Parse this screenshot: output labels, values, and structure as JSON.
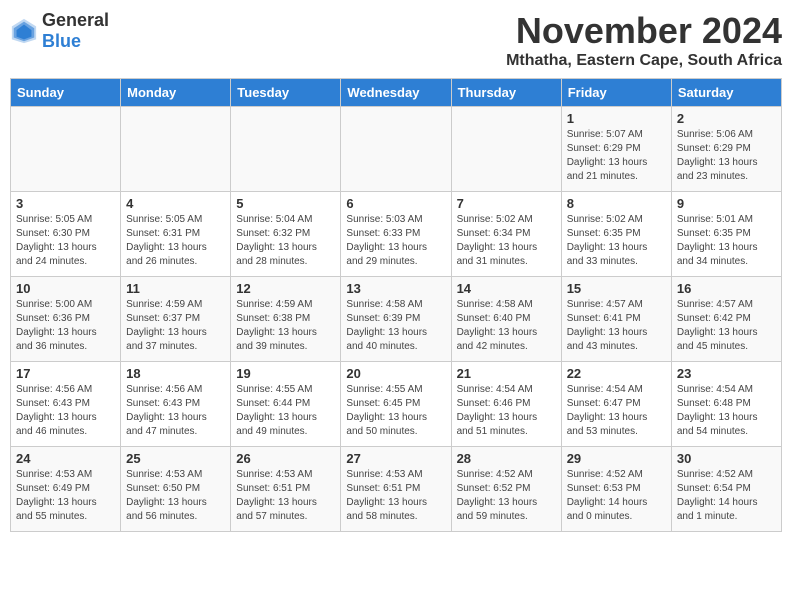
{
  "header": {
    "logo_general": "General",
    "logo_blue": "Blue",
    "month_title": "November 2024",
    "location": "Mthatha, Eastern Cape, South Africa"
  },
  "days_of_week": [
    "Sunday",
    "Monday",
    "Tuesday",
    "Wednesday",
    "Thursday",
    "Friday",
    "Saturday"
  ],
  "weeks": [
    [
      {
        "day": "",
        "info": ""
      },
      {
        "day": "",
        "info": ""
      },
      {
        "day": "",
        "info": ""
      },
      {
        "day": "",
        "info": ""
      },
      {
        "day": "",
        "info": ""
      },
      {
        "day": "1",
        "info": "Sunrise: 5:07 AM\nSunset: 6:29 PM\nDaylight: 13 hours\nand 21 minutes."
      },
      {
        "day": "2",
        "info": "Sunrise: 5:06 AM\nSunset: 6:29 PM\nDaylight: 13 hours\nand 23 minutes."
      }
    ],
    [
      {
        "day": "3",
        "info": "Sunrise: 5:05 AM\nSunset: 6:30 PM\nDaylight: 13 hours\nand 24 minutes."
      },
      {
        "day": "4",
        "info": "Sunrise: 5:05 AM\nSunset: 6:31 PM\nDaylight: 13 hours\nand 26 minutes."
      },
      {
        "day": "5",
        "info": "Sunrise: 5:04 AM\nSunset: 6:32 PM\nDaylight: 13 hours\nand 28 minutes."
      },
      {
        "day": "6",
        "info": "Sunrise: 5:03 AM\nSunset: 6:33 PM\nDaylight: 13 hours\nand 29 minutes."
      },
      {
        "day": "7",
        "info": "Sunrise: 5:02 AM\nSunset: 6:34 PM\nDaylight: 13 hours\nand 31 minutes."
      },
      {
        "day": "8",
        "info": "Sunrise: 5:02 AM\nSunset: 6:35 PM\nDaylight: 13 hours\nand 33 minutes."
      },
      {
        "day": "9",
        "info": "Sunrise: 5:01 AM\nSunset: 6:35 PM\nDaylight: 13 hours\nand 34 minutes."
      }
    ],
    [
      {
        "day": "10",
        "info": "Sunrise: 5:00 AM\nSunset: 6:36 PM\nDaylight: 13 hours\nand 36 minutes."
      },
      {
        "day": "11",
        "info": "Sunrise: 4:59 AM\nSunset: 6:37 PM\nDaylight: 13 hours\nand 37 minutes."
      },
      {
        "day": "12",
        "info": "Sunrise: 4:59 AM\nSunset: 6:38 PM\nDaylight: 13 hours\nand 39 minutes."
      },
      {
        "day": "13",
        "info": "Sunrise: 4:58 AM\nSunset: 6:39 PM\nDaylight: 13 hours\nand 40 minutes."
      },
      {
        "day": "14",
        "info": "Sunrise: 4:58 AM\nSunset: 6:40 PM\nDaylight: 13 hours\nand 42 minutes."
      },
      {
        "day": "15",
        "info": "Sunrise: 4:57 AM\nSunset: 6:41 PM\nDaylight: 13 hours\nand 43 minutes."
      },
      {
        "day": "16",
        "info": "Sunrise: 4:57 AM\nSunset: 6:42 PM\nDaylight: 13 hours\nand 45 minutes."
      }
    ],
    [
      {
        "day": "17",
        "info": "Sunrise: 4:56 AM\nSunset: 6:43 PM\nDaylight: 13 hours\nand 46 minutes."
      },
      {
        "day": "18",
        "info": "Sunrise: 4:56 AM\nSunset: 6:43 PM\nDaylight: 13 hours\nand 47 minutes."
      },
      {
        "day": "19",
        "info": "Sunrise: 4:55 AM\nSunset: 6:44 PM\nDaylight: 13 hours\nand 49 minutes."
      },
      {
        "day": "20",
        "info": "Sunrise: 4:55 AM\nSunset: 6:45 PM\nDaylight: 13 hours\nand 50 minutes."
      },
      {
        "day": "21",
        "info": "Sunrise: 4:54 AM\nSunset: 6:46 PM\nDaylight: 13 hours\nand 51 minutes."
      },
      {
        "day": "22",
        "info": "Sunrise: 4:54 AM\nSunset: 6:47 PM\nDaylight: 13 hours\nand 53 minutes."
      },
      {
        "day": "23",
        "info": "Sunrise: 4:54 AM\nSunset: 6:48 PM\nDaylight: 13 hours\nand 54 minutes."
      }
    ],
    [
      {
        "day": "24",
        "info": "Sunrise: 4:53 AM\nSunset: 6:49 PM\nDaylight: 13 hours\nand 55 minutes."
      },
      {
        "day": "25",
        "info": "Sunrise: 4:53 AM\nSunset: 6:50 PM\nDaylight: 13 hours\nand 56 minutes."
      },
      {
        "day": "26",
        "info": "Sunrise: 4:53 AM\nSunset: 6:51 PM\nDaylight: 13 hours\nand 57 minutes."
      },
      {
        "day": "27",
        "info": "Sunrise: 4:53 AM\nSunset: 6:51 PM\nDaylight: 13 hours\nand 58 minutes."
      },
      {
        "day": "28",
        "info": "Sunrise: 4:52 AM\nSunset: 6:52 PM\nDaylight: 13 hours\nand 59 minutes."
      },
      {
        "day": "29",
        "info": "Sunrise: 4:52 AM\nSunset: 6:53 PM\nDaylight: 14 hours\nand 0 minutes."
      },
      {
        "day": "30",
        "info": "Sunrise: 4:52 AM\nSunset: 6:54 PM\nDaylight: 14 hours\nand 1 minute."
      }
    ]
  ]
}
